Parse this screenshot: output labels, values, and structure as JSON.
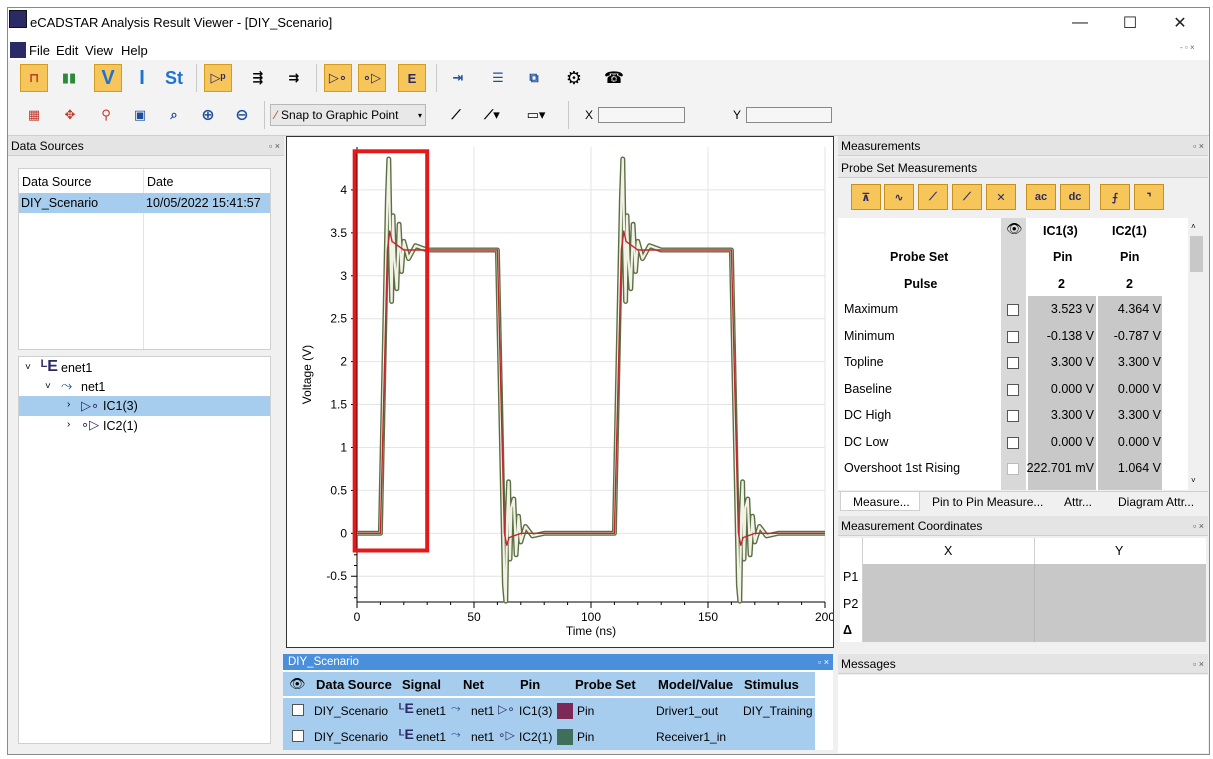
{
  "window": {
    "title": "eCADSTAR Analysis Result Viewer - [DIY_Scenario]",
    "minimize": "—",
    "maximize": "☐",
    "close": "✕"
  },
  "menu": [
    "File",
    "Edit",
    "View",
    "Help"
  ],
  "toolbar": {
    "row1": [
      "waveform-time-icon",
      "histogram-icon",
      "V",
      "I",
      "St",
      "probe-icon",
      "driver-icon",
      "receiver-icon",
      "driver-probe-icon",
      "receiver-probe-icon",
      "enet-icon",
      "export-icon",
      "import-icon",
      "copy-icon",
      "settings-icon",
      "phone-icon"
    ],
    "snap_label": "Snap to Graphic Point",
    "x_label": "X",
    "y_label": "Y"
  },
  "colors": {
    "accent": "#f7c65a",
    "selection": "#a7cdee",
    "wave_fill": "#f3f2e6",
    "wave_outline": "#5c6f44",
    "wave_red": "#c1272d",
    "highlight_box": "#e3191b",
    "ic1_swatch": "#7b2a56",
    "ic2_swatch": "#3f6e5a"
  },
  "data_sources": {
    "panel_title": "Data Sources",
    "col_source": "Data Source",
    "col_date": "Date",
    "rows": [
      {
        "source": "DIY_Scenario",
        "date": "10/05/2022 15:41:57"
      }
    ],
    "tree": {
      "enet": "enet1",
      "net": "net1",
      "ic1": "IC1(3)",
      "ic2": "IC2(1)"
    }
  },
  "chart_data": {
    "type": "line",
    "xlabel": "Time (ns)",
    "ylabel": "Voltage (V)",
    "xlim": [
      0,
      200
    ],
    "ylim": [
      -0.8,
      4.5
    ],
    "x_ticks": [
      0,
      50,
      100,
      150,
      200
    ],
    "y_ticks": [
      -0.5,
      0,
      0.5,
      1,
      1.5,
      2,
      2.5,
      3,
      3.5,
      4
    ],
    "series": [
      {
        "name": "IC1(3)",
        "x": [
          0,
          10,
          13,
          14,
          15,
          20,
          60,
          63,
          64,
          65,
          70,
          110,
          113,
          114,
          115,
          120,
          160,
          163,
          164,
          165,
          170,
          200
        ],
        "y": [
          0,
          0,
          3.3,
          3.52,
          3.4,
          3.3,
          3.3,
          0,
          -0.14,
          -0.05,
          0,
          0,
          3.3,
          3.52,
          3.4,
          3.3,
          3.3,
          0,
          -0.14,
          -0.05,
          0,
          0
        ]
      },
      {
        "name": "IC2(1)",
        "x": [
          0,
          10,
          12,
          13,
          13.6,
          14.2,
          14.8,
          15.4,
          16,
          17,
          18,
          19,
          20,
          22,
          25,
          30,
          60,
          62,
          63,
          63.6,
          64.2,
          64.8,
          65.4,
          66,
          67,
          68,
          69,
          70,
          72,
          75,
          80,
          110,
          112,
          113,
          113.6,
          114.2,
          114.8,
          115.4,
          116,
          117,
          118,
          119,
          120,
          122,
          125,
          130,
          160,
          162,
          163,
          163.6,
          164.2,
          164.8,
          165.4,
          166,
          167,
          168,
          169,
          170,
          172,
          175,
          180,
          200
        ],
        "y": [
          0,
          0,
          2.6,
          3.9,
          4.36,
          3.4,
          2.7,
          3.7,
          3.2,
          2.85,
          3.6,
          3.05,
          3.4,
          3.2,
          3.35,
          3.3,
          3.3,
          0.7,
          -0.6,
          -0.79,
          0.2,
          0.6,
          -0.3,
          0.3,
          0.4,
          -0.25,
          0.2,
          -0.1,
          0.08,
          -0.03,
          0,
          0,
          2.6,
          3.9,
          4.36,
          3.4,
          2.7,
          3.7,
          3.2,
          2.85,
          3.6,
          3.05,
          3.4,
          3.2,
          3.35,
          3.3,
          3.3,
          0.7,
          -0.6,
          -0.79,
          0.2,
          0.6,
          -0.3,
          0.3,
          0.4,
          -0.25,
          0.2,
          -0.1,
          0.08,
          -0.03,
          0,
          0
        ]
      }
    ],
    "grid": true
  },
  "probe_table": {
    "panel_title": "DIY_Scenario",
    "headers": [
      "Data Source",
      "Signal",
      "Net",
      "Pin",
      "Probe Set",
      "Model/Value",
      "Stimulus"
    ],
    "rows": [
      {
        "source": "DIY_Scenario",
        "signal": "enet1",
        "net": "net1",
        "pin": "IC1(3)",
        "probe": "Pin",
        "model": "Driver1_out",
        "stimulus": "DIY_Training"
      },
      {
        "source": "DIY_Scenario",
        "signal": "enet1",
        "net": "net1",
        "pin": "IC2(1)",
        "probe": "Pin",
        "model": "Receiver1_in",
        "stimulus": ""
      }
    ]
  },
  "measurements": {
    "panel_title": "Measurements",
    "sub_title": "Probe Set Measurements",
    "buttons": [
      "maximum-icon",
      "minimum-icon",
      "rise-icon",
      "fall-icon",
      "crossing-icon",
      "ac",
      "dc",
      "rising-edge-icon",
      "falling-edge-icon"
    ],
    "col_ic1": "IC1(3)",
    "col_ic2": "IC2(1)",
    "probe_set_label": "Probe Set",
    "probe_set_ic1": "Pin",
    "probe_set_ic2": "Pin",
    "pulse_label": "Pulse",
    "pulse_ic1": "2",
    "pulse_ic2": "2",
    "rows": [
      {
        "name": "Maximum",
        "ic1": "3.523 V",
        "ic2": "4.364 V"
      },
      {
        "name": "Minimum",
        "ic1": "-0.138 V",
        "ic2": "-0.787 V"
      },
      {
        "name": "Topline",
        "ic1": "3.300 V",
        "ic2": "3.300 V"
      },
      {
        "name": "Baseline",
        "ic1": "0.000 V",
        "ic2": "0.000 V"
      },
      {
        "name": "DC High",
        "ic1": "3.300 V",
        "ic2": "3.300 V"
      },
      {
        "name": "DC Low",
        "ic1": "0.000 V",
        "ic2": "0.000 V"
      },
      {
        "name": "Overshoot 1st Rising",
        "ic1": "222.701 mV",
        "ic2": "1.064 V"
      }
    ],
    "tabs": [
      "Measure...",
      "Pin to Pin Measure...",
      "Attr...",
      "Diagram Attr..."
    ]
  },
  "coords": {
    "panel_title": "Measurement Coordinates",
    "col_x": "X",
    "col_y": "Y",
    "rows": [
      "P1",
      "P2",
      "Δ"
    ]
  },
  "messages": {
    "panel_title": "Messages"
  }
}
